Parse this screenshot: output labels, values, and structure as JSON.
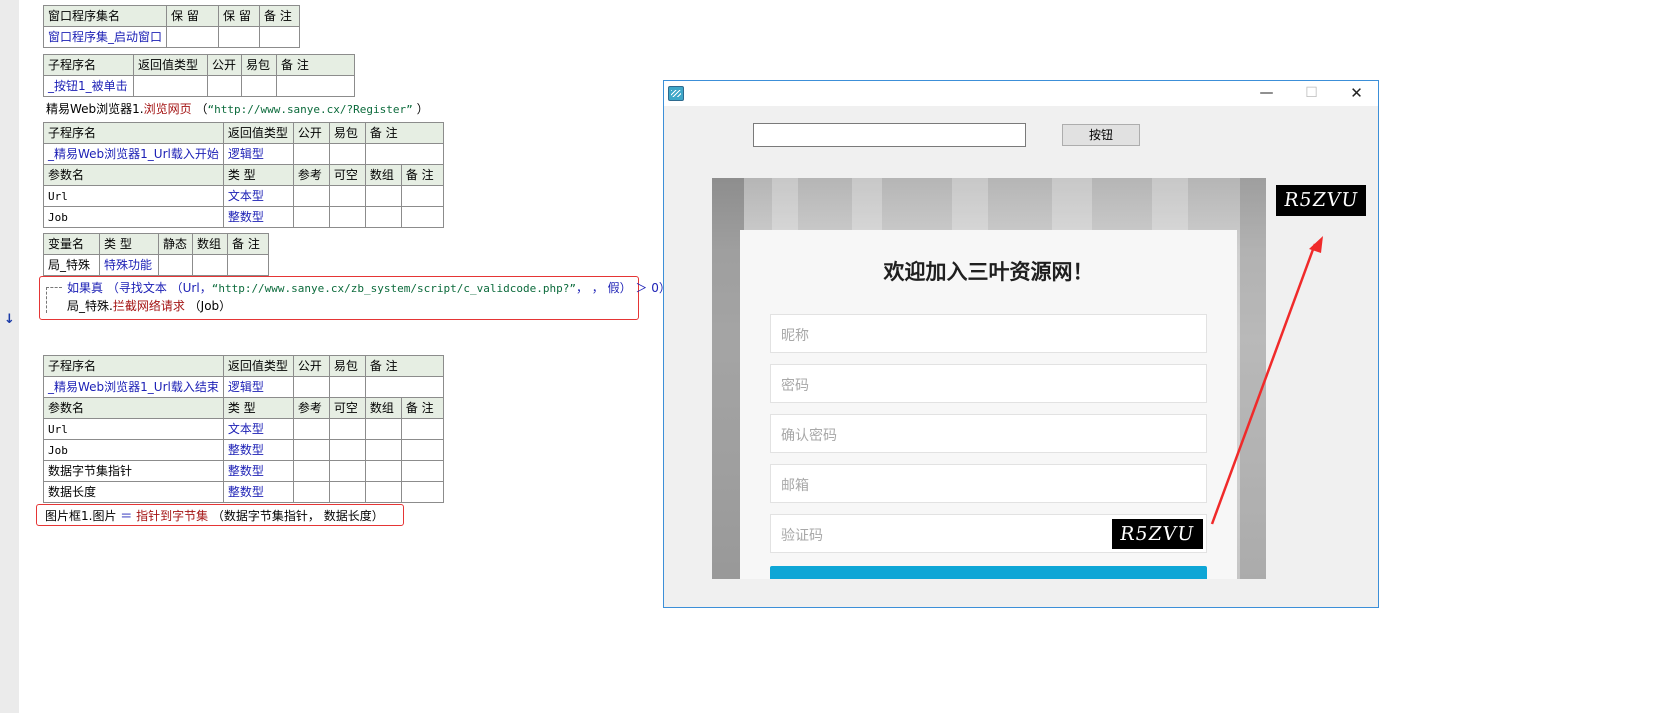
{
  "gutter": {
    "arrow_glyph": "↓"
  },
  "t1": {
    "header": [
      "窗口程序集名",
      "保 留",
      "保 留",
      "备 注"
    ],
    "row": [
      "窗口程序集_启动窗口",
      "",
      "",
      ""
    ]
  },
  "t2": {
    "header": [
      "子程序名",
      "返回值类型",
      "公开",
      "易包",
      "备 注"
    ],
    "row": [
      "_按钮1_被单击",
      "",
      "",
      "",
      ""
    ]
  },
  "line_browse": {
    "obj": "精易Web浏览器1.",
    "method": "浏览网页",
    "open": " （",
    "arg": "“http://www.sanye.cx/?Register”",
    "close": " ）"
  },
  "t3": {
    "header": [
      "子程序名",
      "返回值类型",
      "公开",
      "易包",
      "备 注"
    ],
    "row": [
      "_精易Web浏览器1_Url载入开始",
      "逻辑型",
      "",
      "",
      ""
    ],
    "param_header": [
      "参数名",
      "类 型",
      "参考",
      "可空",
      "数组",
      "备 注"
    ],
    "params": [
      [
        "Url",
        "文本型"
      ],
      [
        "Job",
        "整数型"
      ]
    ]
  },
  "t4": {
    "header": [
      "变量名",
      "类 型",
      "静态",
      "数组",
      "备 注"
    ],
    "row": [
      "局_特殊",
      "特殊功能",
      "",
      "",
      ""
    ]
  },
  "ifblock": {
    "kw": "如果真",
    "fn_open": " （寻找文本 （Url，",
    "str": "“http://www.sanye.cx/zb_system/script/c_validcode.php?”",
    "rest": "， ， 假） ＞ 0）",
    "line2_obj": "局_特殊.",
    "line2_method": "拦截网络请求",
    "line2_args": " （Job）"
  },
  "t5": {
    "header": [
      "子程序名",
      "返回值类型",
      "公开",
      "易包",
      "备 注"
    ],
    "row": [
      "_精易Web浏览器1_Url载入结束",
      "逻辑型",
      "",
      "",
      ""
    ],
    "param_header": [
      "参数名",
      "类 型",
      "参考",
      "可空",
      "数组",
      "备 注"
    ],
    "params": [
      [
        "Url",
        "文本型"
      ],
      [
        "Job",
        "整数型"
      ],
      [
        "数据字节集指针",
        "整数型"
      ],
      [
        "数据长度",
        "整数型"
      ]
    ]
  },
  "line_pic": {
    "lhs": "图片框1.图片",
    "eq": " ＝ ",
    "fn": "指针到字节集",
    "args": " （数据字节集指针， 数据长度）"
  },
  "window": {
    "title": "",
    "min_glyph": "—",
    "max_glyph": "☐",
    "close_glyph": "✕",
    "input_value": "",
    "button_label": "按钮",
    "captcha_text": "R5ZVU"
  },
  "web": {
    "title": "欢迎加入三叶资源网！",
    "fields": [
      "昵称",
      "密码",
      "确认密码",
      "邮箱",
      "验证码"
    ],
    "captcha_text": "R5ZVU"
  },
  "colors": {
    "accent_red": "#e53535",
    "window_border": "#3c8fd8",
    "submit": "#0ea6d6"
  }
}
